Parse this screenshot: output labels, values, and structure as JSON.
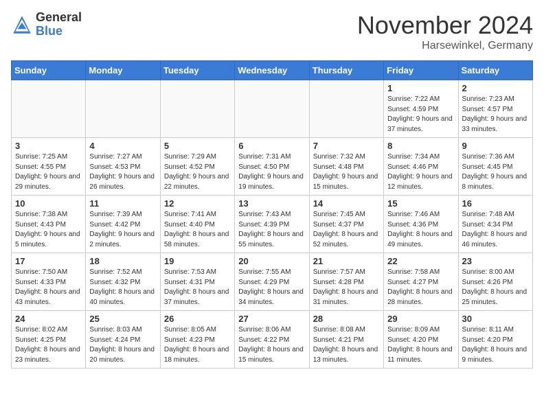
{
  "logo": {
    "general": "General",
    "blue": "Blue"
  },
  "header": {
    "month": "November 2024",
    "location": "Harsewinkel, Germany"
  },
  "weekdays": [
    "Sunday",
    "Monday",
    "Tuesday",
    "Wednesday",
    "Thursday",
    "Friday",
    "Saturday"
  ],
  "weeks": [
    [
      {
        "day": "",
        "info": ""
      },
      {
        "day": "",
        "info": ""
      },
      {
        "day": "",
        "info": ""
      },
      {
        "day": "",
        "info": ""
      },
      {
        "day": "",
        "info": ""
      },
      {
        "day": "1",
        "info": "Sunrise: 7:22 AM\nSunset: 4:59 PM\nDaylight: 9 hours and 37 minutes."
      },
      {
        "day": "2",
        "info": "Sunrise: 7:23 AM\nSunset: 4:57 PM\nDaylight: 9 hours and 33 minutes."
      }
    ],
    [
      {
        "day": "3",
        "info": "Sunrise: 7:25 AM\nSunset: 4:55 PM\nDaylight: 9 hours and 29 minutes."
      },
      {
        "day": "4",
        "info": "Sunrise: 7:27 AM\nSunset: 4:53 PM\nDaylight: 9 hours and 26 minutes."
      },
      {
        "day": "5",
        "info": "Sunrise: 7:29 AM\nSunset: 4:52 PM\nDaylight: 9 hours and 22 minutes."
      },
      {
        "day": "6",
        "info": "Sunrise: 7:31 AM\nSunset: 4:50 PM\nDaylight: 9 hours and 19 minutes."
      },
      {
        "day": "7",
        "info": "Sunrise: 7:32 AM\nSunset: 4:48 PM\nDaylight: 9 hours and 15 minutes."
      },
      {
        "day": "8",
        "info": "Sunrise: 7:34 AM\nSunset: 4:46 PM\nDaylight: 9 hours and 12 minutes."
      },
      {
        "day": "9",
        "info": "Sunrise: 7:36 AM\nSunset: 4:45 PM\nDaylight: 9 hours and 8 minutes."
      }
    ],
    [
      {
        "day": "10",
        "info": "Sunrise: 7:38 AM\nSunset: 4:43 PM\nDaylight: 9 hours and 5 minutes."
      },
      {
        "day": "11",
        "info": "Sunrise: 7:39 AM\nSunset: 4:42 PM\nDaylight: 9 hours and 2 minutes."
      },
      {
        "day": "12",
        "info": "Sunrise: 7:41 AM\nSunset: 4:40 PM\nDaylight: 8 hours and 58 minutes."
      },
      {
        "day": "13",
        "info": "Sunrise: 7:43 AM\nSunset: 4:39 PM\nDaylight: 8 hours and 55 minutes."
      },
      {
        "day": "14",
        "info": "Sunrise: 7:45 AM\nSunset: 4:37 PM\nDaylight: 8 hours and 52 minutes."
      },
      {
        "day": "15",
        "info": "Sunrise: 7:46 AM\nSunset: 4:36 PM\nDaylight: 8 hours and 49 minutes."
      },
      {
        "day": "16",
        "info": "Sunrise: 7:48 AM\nSunset: 4:34 PM\nDaylight: 8 hours and 46 minutes."
      }
    ],
    [
      {
        "day": "17",
        "info": "Sunrise: 7:50 AM\nSunset: 4:33 PM\nDaylight: 8 hours and 43 minutes."
      },
      {
        "day": "18",
        "info": "Sunrise: 7:52 AM\nSunset: 4:32 PM\nDaylight: 8 hours and 40 minutes."
      },
      {
        "day": "19",
        "info": "Sunrise: 7:53 AM\nSunset: 4:31 PM\nDaylight: 8 hours and 37 minutes."
      },
      {
        "day": "20",
        "info": "Sunrise: 7:55 AM\nSunset: 4:29 PM\nDaylight: 8 hours and 34 minutes."
      },
      {
        "day": "21",
        "info": "Sunrise: 7:57 AM\nSunset: 4:28 PM\nDaylight: 8 hours and 31 minutes."
      },
      {
        "day": "22",
        "info": "Sunrise: 7:58 AM\nSunset: 4:27 PM\nDaylight: 8 hours and 28 minutes."
      },
      {
        "day": "23",
        "info": "Sunrise: 8:00 AM\nSunset: 4:26 PM\nDaylight: 8 hours and 25 minutes."
      }
    ],
    [
      {
        "day": "24",
        "info": "Sunrise: 8:02 AM\nSunset: 4:25 PM\nDaylight: 8 hours and 23 minutes."
      },
      {
        "day": "25",
        "info": "Sunrise: 8:03 AM\nSunset: 4:24 PM\nDaylight: 8 hours and 20 minutes."
      },
      {
        "day": "26",
        "info": "Sunrise: 8:05 AM\nSunset: 4:23 PM\nDaylight: 8 hours and 18 minutes."
      },
      {
        "day": "27",
        "info": "Sunrise: 8:06 AM\nSunset: 4:22 PM\nDaylight: 8 hours and 15 minutes."
      },
      {
        "day": "28",
        "info": "Sunrise: 8:08 AM\nSunset: 4:21 PM\nDaylight: 8 hours and 13 minutes."
      },
      {
        "day": "29",
        "info": "Sunrise: 8:09 AM\nSunset: 4:20 PM\nDaylight: 8 hours and 11 minutes."
      },
      {
        "day": "30",
        "info": "Sunrise: 8:11 AM\nSunset: 4:20 PM\nDaylight: 8 hours and 9 minutes."
      }
    ]
  ]
}
